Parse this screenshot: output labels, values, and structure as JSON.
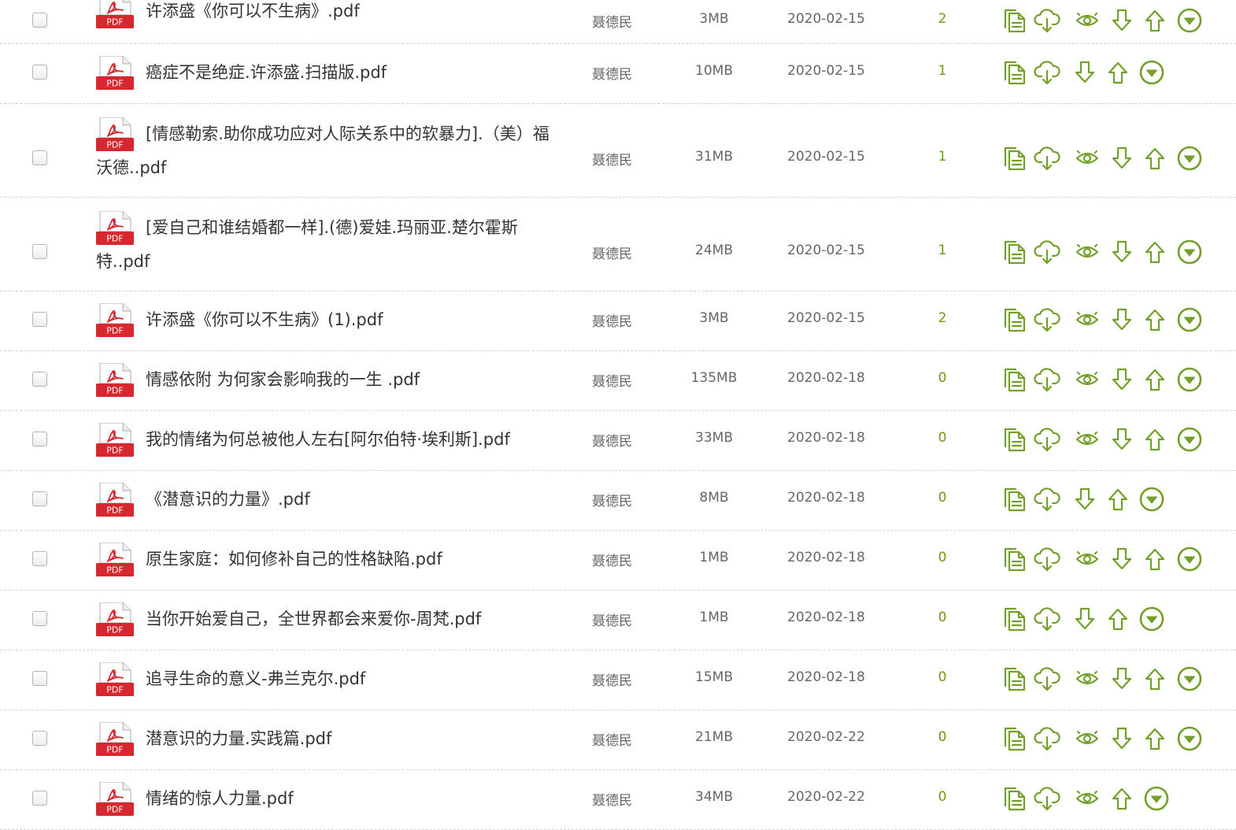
{
  "colors": {
    "accent": "#72a02a",
    "pdf_red": "#d7282f",
    "count": "#6a9b10"
  },
  "action_icons": [
    "copy-icon",
    "cloud-download-icon",
    "preview-eye-icon",
    "arrow-down-icon",
    "arrow-up-icon",
    "circle-chevron-down-icon"
  ],
  "files": [
    {
      "line1": "许添盛《你可以不生病》.pdf",
      "line2": "",
      "uploader": "聂德民",
      "size": "3MB",
      "date": "2020-02-15",
      "count": "2",
      "preview": true
    },
    {
      "line1": "癌症不是绝症.许添盛.扫描版.pdf",
      "line2": "",
      "uploader": "聂德民",
      "size": "10MB",
      "date": "2020-02-15",
      "count": "1",
      "preview": false
    },
    {
      "line1": "[情感勒索.助你成功应对人际关系中的软暴力].（美）福",
      "line2": "沃德..pdf",
      "uploader": "聂德民",
      "size": "31MB",
      "date": "2020-02-15",
      "count": "1",
      "preview": true
    },
    {
      "line1": "[爱自己和谁结婚都一样].(德)爱娃.玛丽亚.楚尔霍斯",
      "line2": "特..pdf",
      "uploader": "聂德民",
      "size": "24MB",
      "date": "2020-02-15",
      "count": "1",
      "preview": true
    },
    {
      "line1": "许添盛《你可以不生病》(1).pdf",
      "line2": "",
      "uploader": "聂德民",
      "size": "3MB",
      "date": "2020-02-15",
      "count": "2",
      "preview": true
    },
    {
      "line1": "情感依附 为何家会影响我的一生 .pdf",
      "line2": "",
      "uploader": "聂德民",
      "size": "135MB",
      "date": "2020-02-18",
      "count": "0",
      "preview": true
    },
    {
      "line1": "我的情绪为何总被他人左右[阿尔伯特·埃利斯].pdf",
      "line2": "",
      "uploader": "聂德民",
      "size": "33MB",
      "date": "2020-02-18",
      "count": "0",
      "preview": true
    },
    {
      "line1": "《潜意识的力量》.pdf",
      "line2": "",
      "uploader": "聂德民",
      "size": "8MB",
      "date": "2020-02-18",
      "count": "0",
      "preview": false
    },
    {
      "line1": "原生家庭：如何修补自己的性格缺陷.pdf",
      "line2": "",
      "uploader": "聂德民",
      "size": "1MB",
      "date": "2020-02-18",
      "count": "0",
      "preview": true
    },
    {
      "line1": "当你开始爱自己，全世界都会来爱你-周梵.pdf",
      "line2": "",
      "uploader": "聂德民",
      "size": "1MB",
      "date": "2020-02-18",
      "count": "0",
      "preview": false
    },
    {
      "line1": "追寻生命的意义-弗兰克尔.pdf",
      "line2": "",
      "uploader": "聂德民",
      "size": "15MB",
      "date": "2020-02-18",
      "count": "0",
      "preview": true
    },
    {
      "line1": "潜意识的力量.实践篇.pdf",
      "line2": "",
      "uploader": "聂德民",
      "size": "21MB",
      "date": "2020-02-22",
      "count": "0",
      "preview": true
    },
    {
      "line1": "情绪的惊人力量.pdf",
      "line2": "",
      "uploader": "聂德民",
      "size": "34MB",
      "date": "2020-02-22",
      "count": "0",
      "preview": true,
      "no_down": true
    }
  ]
}
